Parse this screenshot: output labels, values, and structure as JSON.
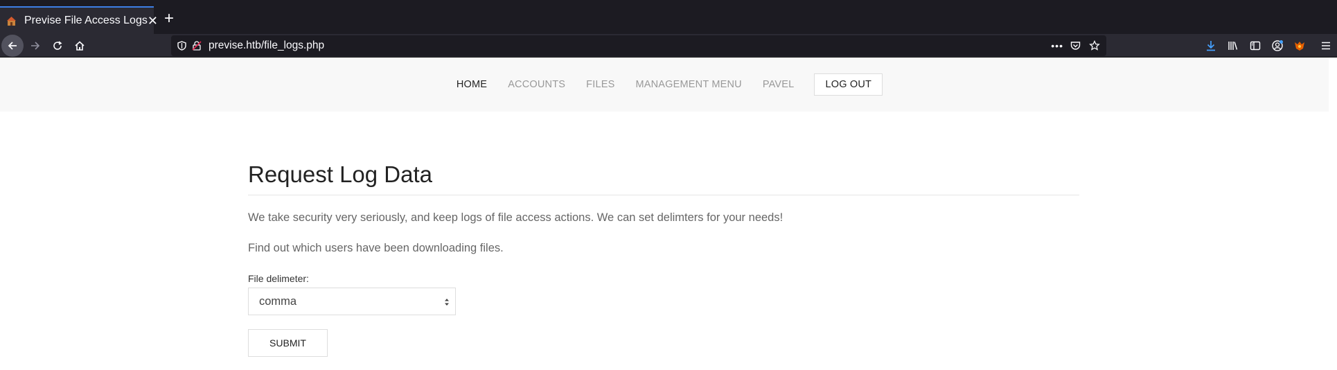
{
  "browser": {
    "tab": {
      "title": "Previse File Access Logs",
      "close": "✕"
    },
    "new_tab": "+",
    "url": "previse.htb/file_logs.php",
    "url_more": "•••"
  },
  "header": {
    "menu": [
      {
        "label": "HOME",
        "active": true
      },
      {
        "label": "ACCOUNTS"
      },
      {
        "label": "FILES"
      },
      {
        "label": "MANAGEMENT MENU"
      },
      {
        "label": "PAVEL"
      },
      {
        "label": "LOG OUT"
      }
    ]
  },
  "main": {
    "title": "Request Log Data",
    "paragraph1": "We take security very seriously, and keep logs of file access actions. We can set delimters for your needs!",
    "paragraph2": "Find out which users have been downloading files.",
    "delimiter_label": "File delimeter:",
    "delimiter_value": "comma",
    "submit_label": "SUBMIT"
  },
  "colors": {
    "accent": "#3d7fe6",
    "chrome_dark": "#1c1b22",
    "chrome": "#2b2a33",
    "download_blue": "#45a1ff"
  }
}
